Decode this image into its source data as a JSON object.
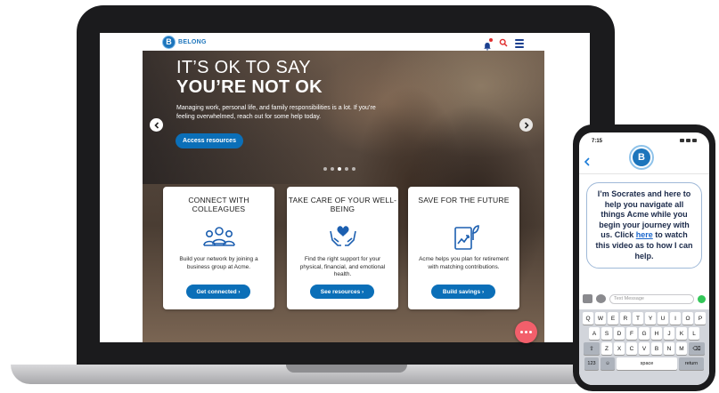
{
  "site": {
    "brand_letter": "B",
    "brand_name": "BELONG"
  },
  "hero": {
    "title_line1": "IT’S OK TO SAY",
    "title_line2": "YOU’RE NOT OK",
    "body": "Managing work, personal life, and family responsibilities is a lot. If you’re feeling overwhelmed, reach out for some help today.",
    "cta_label": "Access resources"
  },
  "cards": [
    {
      "title": "CONNECT WITH COLLEAGUES",
      "icon": "people-network-icon",
      "description": "Build your network by joining a business group at Acme.",
      "button_label": "Get connected ›"
    },
    {
      "title": "TAKE CARE OF YOUR WELL-BEING",
      "icon": "heart-hands-icon",
      "description": "Find the right support for your physical, financial, and emotional health.",
      "button_label": "See resources ›"
    },
    {
      "title": "SAVE FOR THE FUTURE",
      "icon": "savings-growth-icon",
      "description": "Acme helps you plan for retirement with matching contributions.",
      "button_label": "Build savings ›"
    }
  ],
  "phone": {
    "time": "7:15",
    "avatar_letter": "B",
    "message_before_link": "I’m Socrates and here to help you navigate all things Acme while you begin your journey with us. Click ",
    "message_link": "here",
    "message_after_link": " to watch this video as to how I can help.",
    "input_placeholder": "Text Message",
    "keyboard": {
      "row1": [
        "Q",
        "W",
        "E",
        "R",
        "T",
        "Y",
        "U",
        "I",
        "O",
        "P"
      ],
      "row2": [
        "A",
        "S",
        "D",
        "F",
        "G",
        "H",
        "J",
        "K",
        "L"
      ],
      "row3": [
        "Z",
        "X",
        "C",
        "V",
        "B",
        "N",
        "M"
      ],
      "num_label": "123",
      "space_label": "space",
      "return_label": "return"
    }
  },
  "colors": {
    "primary_blue": "#0b6fb8",
    "brand_blue": "#1c75bc",
    "fab_pink": "#f25f6b",
    "bell_dot": "#e02d2d"
  }
}
